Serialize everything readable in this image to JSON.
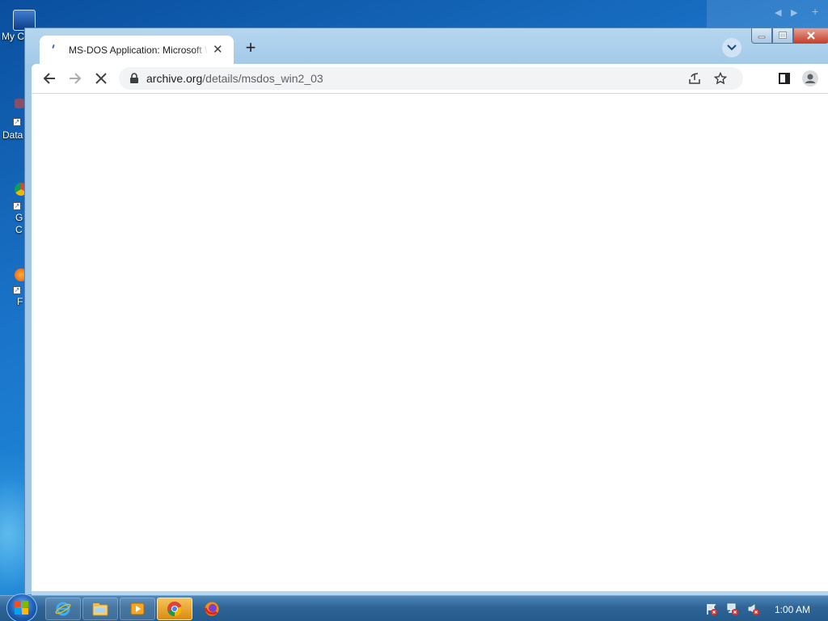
{
  "desktop": {
    "icons": [
      {
        "label": "My C"
      },
      {
        "label": "Data"
      },
      {
        "label": "G"
      },
      {
        "label": "C"
      },
      {
        "label": "F"
      }
    ]
  },
  "browser": {
    "tab": {
      "title": "MS-DOS Application: Microsoft W",
      "close": "✕"
    },
    "new_tab": "+",
    "url_host": "archive.org",
    "url_path": "/details/msdos_win2_03"
  },
  "taskbar": {
    "clock": "1:00 AM"
  },
  "colors": {
    "desktop": "#1a73c8",
    "taskbar": "#2f6496",
    "window_frame": "#a3cae9",
    "close_button": "#c4412b"
  }
}
